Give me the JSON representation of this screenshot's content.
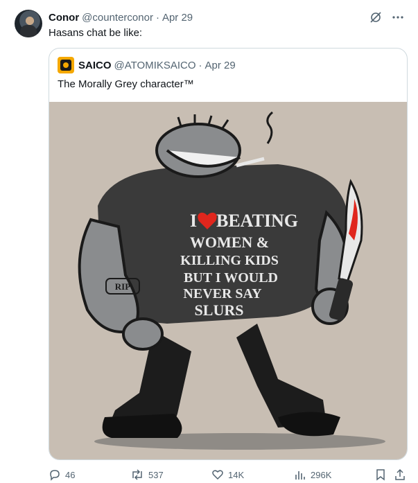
{
  "tweet": {
    "author_name": "Conor",
    "author_handle": "@counterconor",
    "separator": "·",
    "date": "Apr 29",
    "text": "Hasans chat be like:"
  },
  "quoted": {
    "author_name": "SAICO",
    "author_handle": "@ATOMIKSAICO",
    "separator": "·",
    "date": "Apr 29",
    "text": "The Morally Grey character™",
    "image_text": {
      "line1_start": "I",
      "line1_end": "BEATING",
      "line2": "WOMEN &",
      "line3": "KILLING KIDS",
      "line4": "BUT I WOULD",
      "line5": "NEVER SAY",
      "line6": "SLURS",
      "tattoo": "RIP"
    }
  },
  "actions": {
    "replies": "46",
    "reposts": "537",
    "likes": "14K",
    "views": "296K"
  },
  "colors": {
    "accent_red": "#e0261d",
    "shirt": "#3a3a3a",
    "skin": "#8a8c8e",
    "background": "#c8beb3"
  },
  "icons": [
    "grok-icon",
    "more-icon",
    "reply-icon",
    "repost-icon",
    "like-icon",
    "views-icon",
    "bookmark-icon",
    "share-icon"
  ]
}
